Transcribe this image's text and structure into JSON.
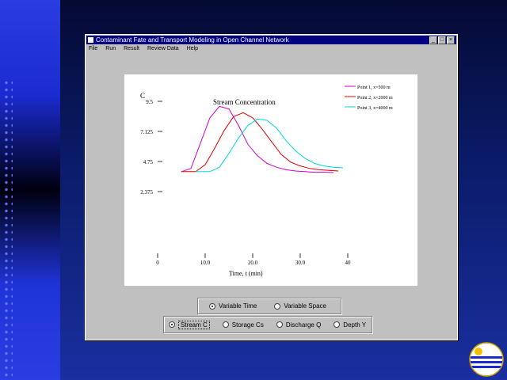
{
  "window": {
    "title": "Contaminant Fate and Transport Modeling in Open Channel Network",
    "minimize": "_",
    "maximize": "□",
    "close": "×"
  },
  "menu": [
    "File",
    "Run",
    "Result",
    "Review Data",
    "Help"
  ],
  "chart_data": {
    "type": "line",
    "title": "Stream Concentration",
    "ylabel": "C",
    "xlabel": "Time, t (min)",
    "ylim": [
      0,
      9.5
    ],
    "xlim": [
      0,
      40
    ],
    "yticks": [
      "2.375",
      "4.75",
      "7.125",
      "9.5"
    ],
    "xticks": [
      "0",
      "10.0",
      "20.0",
      "30.0",
      "40"
    ],
    "grid": false,
    "legend_position": "top-right",
    "series": [
      {
        "name": "Point 1, x=500 m",
        "color": "#d000d0",
        "x": [
          5,
          7,
          9,
          11,
          13,
          15,
          17,
          19,
          21,
          23,
          25,
          27,
          29,
          31,
          33,
          35,
          37
        ],
        "y": [
          3.95,
          4.2,
          6.2,
          8.2,
          9.1,
          8.9,
          7.6,
          6.1,
          5.2,
          4.6,
          4.3,
          4.1,
          4.0,
          3.95,
          3.9,
          3.9,
          3.88
        ]
      },
      {
        "name": "Point 2, x=2000 m",
        "color": "#e00000",
        "x": [
          5,
          8,
          10,
          12,
          14,
          16,
          18,
          20,
          22,
          24,
          26,
          28,
          30,
          32,
          34,
          36,
          38
        ],
        "y": [
          3.95,
          3.95,
          4.5,
          5.8,
          7.2,
          8.3,
          8.6,
          8.2,
          7.3,
          6.3,
          5.3,
          4.7,
          4.4,
          4.2,
          4.1,
          4.05,
          4.0
        ]
      },
      {
        "name": "Point 3, x=4000 m",
        "color": "#00d8d8",
        "x": [
          8,
          11,
          13,
          15,
          17,
          19,
          21,
          23,
          25,
          27,
          29,
          31,
          33,
          35,
          37,
          39
        ],
        "y": [
          3.95,
          3.95,
          4.3,
          5.4,
          6.6,
          7.6,
          8.1,
          8.0,
          7.4,
          6.4,
          5.6,
          5.0,
          4.6,
          4.4,
          4.3,
          4.25
        ]
      }
    ]
  },
  "mode_options": [
    {
      "label": "Variable Time",
      "checked": true
    },
    {
      "label": "Variable Space",
      "checked": false
    }
  ],
  "variable_options": [
    {
      "label": "Stream C",
      "checked": true
    },
    {
      "label": "Storage Cs",
      "checked": false
    },
    {
      "label": "Discharge Q",
      "checked": false
    },
    {
      "label": "Depth Y",
      "checked": false
    }
  ]
}
